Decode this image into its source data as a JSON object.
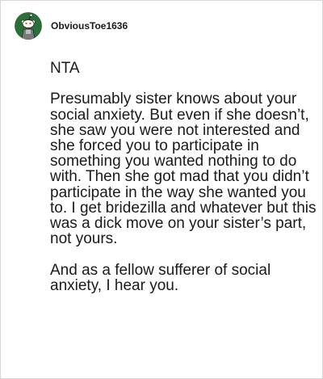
{
  "comment": {
    "username": "ObviousToe1636",
    "avatar_icon": "snoo-avatar-icon",
    "paragraphs": [
      "NTA",
      "Presumably sister knows about your social anxiety. But even if she doesn’t, she saw you were not interested and she forced you to participate in something you wanted nothing to do with. Then she got mad that you didn’t participate in the way she wanted you to. I get bridezilla and whatever but this was a dick move on your sister’s part, not yours.",
      "And as a fellow sufferer of social anxiety, I hear you."
    ]
  }
}
